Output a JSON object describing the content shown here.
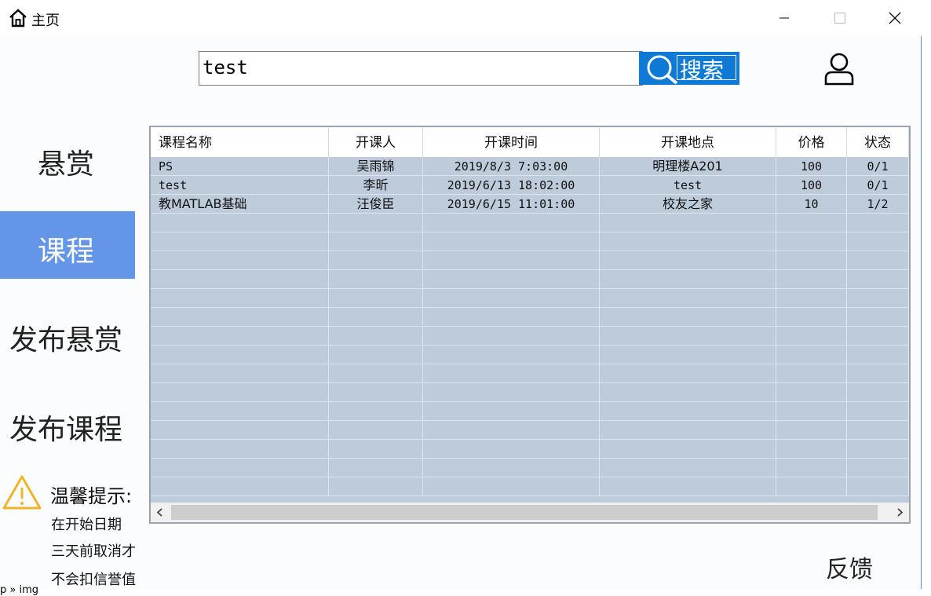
{
  "window": {
    "title": "主页"
  },
  "search": {
    "value": "test",
    "button_label": "搜索"
  },
  "nav": {
    "items": [
      {
        "label": "悬赏"
      },
      {
        "label": "课程"
      },
      {
        "label": "发布悬赏"
      },
      {
        "label": "发布课程"
      }
    ],
    "active": "课程"
  },
  "tip": {
    "title": "温馨提示:",
    "lines": [
      "在开始日期",
      "三天前取消才",
      "不会扣信誉值"
    ]
  },
  "table": {
    "columns": [
      "课程名称",
      "开课人",
      "开课时间",
      "开课地点",
      "价格",
      "状态"
    ],
    "rows": [
      [
        "PS",
        "吴雨锦",
        "2019/8/3 7:03:00",
        "明理楼A201",
        "100",
        "0/1"
      ],
      [
        "test",
        "李昕",
        "2019/6/13 18:02:00",
        "test",
        "100",
        "0/1"
      ],
      [
        "教MATLAB基础",
        "汪俊臣",
        "2019/6/15 11:01:00",
        "校友之家",
        "10",
        "1/2"
      ]
    ],
    "empty_rows": 15,
    "selected_row_color": "#bdcbdb"
  },
  "feedback": {
    "label": "反馈"
  },
  "status_fragment": "p » img",
  "colors": {
    "accent": "#0f7ad6",
    "nav_active": "#6496e8",
    "grid_bg": "#bdcbdb"
  }
}
